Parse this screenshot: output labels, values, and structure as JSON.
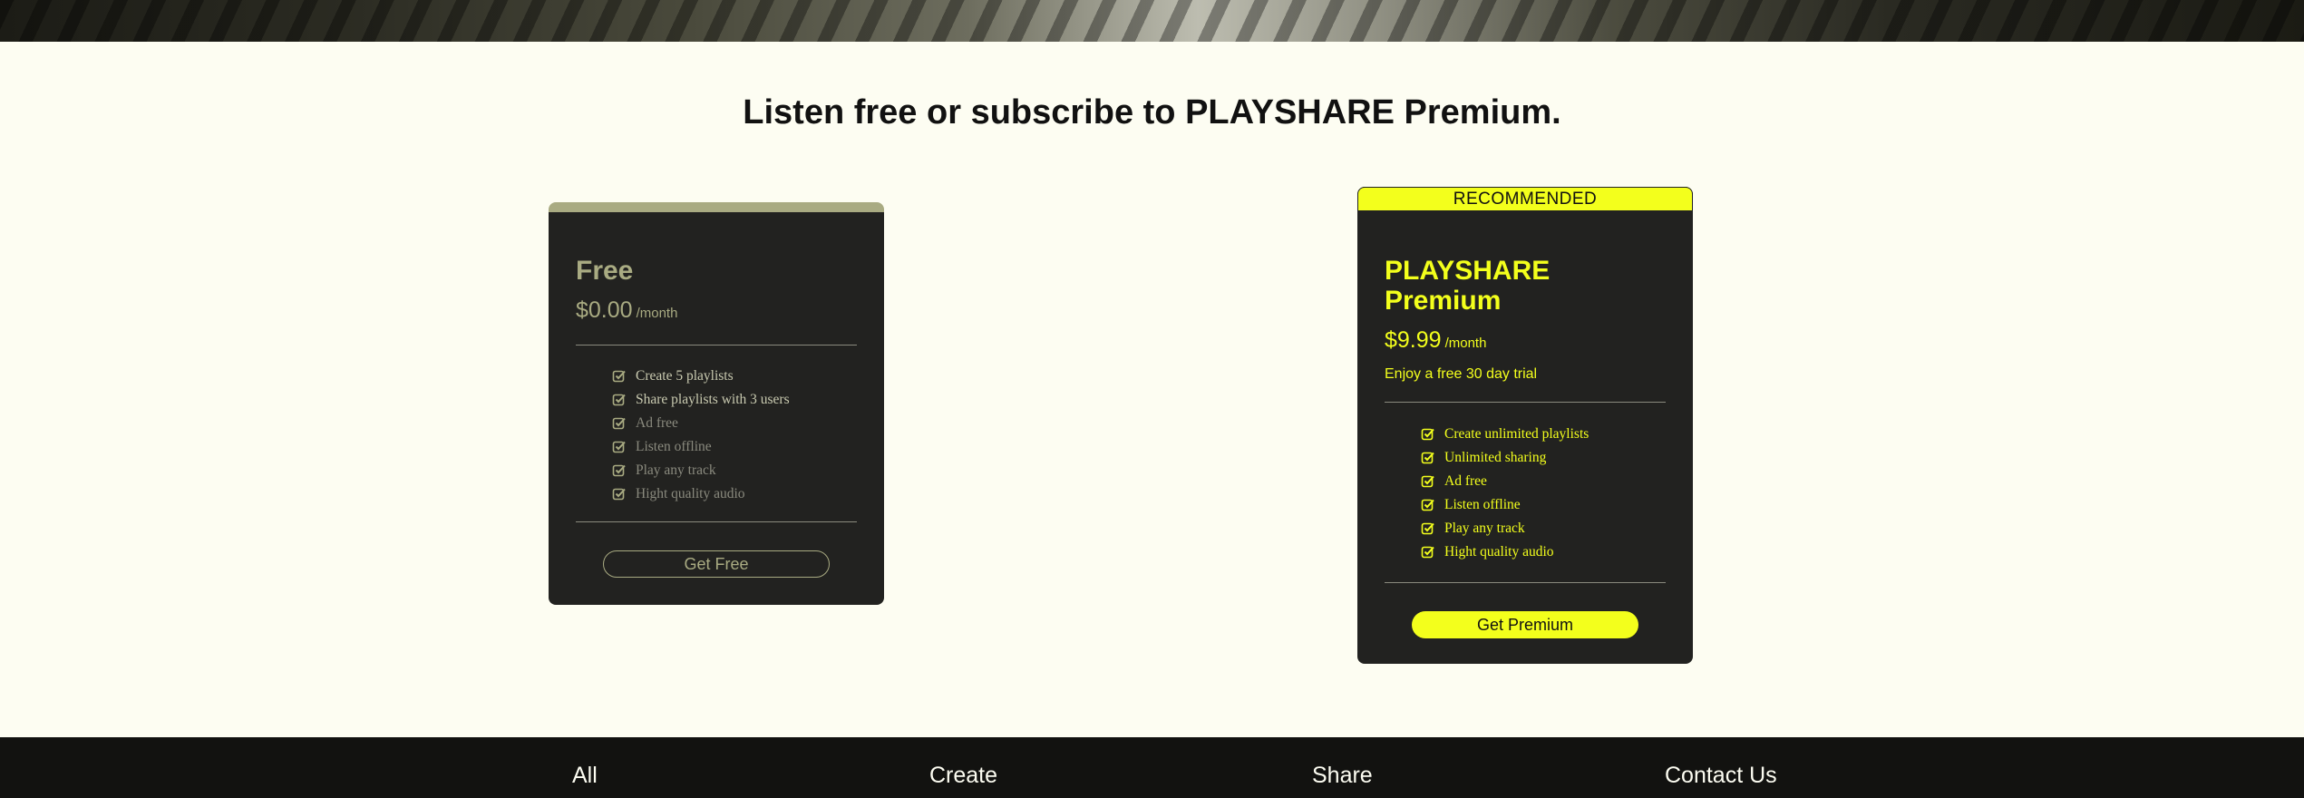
{
  "headline": {
    "part1": "Listen free or ",
    "part2": "subscribe",
    "part3": " to ",
    "part4": "PLAY",
    "part5": "SHARE",
    "part6": " ",
    "part7": "Premium",
    "part8": "."
  },
  "free_plan": {
    "name": "Free",
    "price": "$0.00",
    "period": "/month",
    "features": [
      {
        "label": "Create 5 playlists",
        "included": true
      },
      {
        "label": "Share playlists with 3 users",
        "included": true
      },
      {
        "label": "Ad free",
        "included": false
      },
      {
        "label": "Listen offline",
        "included": false
      },
      {
        "label": "Play any track",
        "included": false
      },
      {
        "label": "Hight quality audio",
        "included": false
      }
    ],
    "button_label": "Get Free"
  },
  "premium_plan": {
    "badge": "RECOMMENDED",
    "name_line1": "PLAYSHARE",
    "name_line2": "Premium",
    "price": "$9.99",
    "period": "/month",
    "trial": "Enjoy a free 30 day trial",
    "features": [
      {
        "label": "Create unlimited playlists"
      },
      {
        "label": "Unlimited sharing"
      },
      {
        "label": "Ad free"
      },
      {
        "label": "Listen offline"
      },
      {
        "label": "Play any track"
      },
      {
        "label": "Hight quality audio"
      }
    ],
    "button_label": "Get Premium"
  },
  "footer": {
    "links": [
      "All",
      "Create",
      "Share",
      "Contact Us"
    ]
  },
  "colors": {
    "accent": "#f3ff1c",
    "muted_accent": "#a9ab82",
    "card_bg": "#222220",
    "page_bg": "#fdfdf2",
    "footer_bg": "#121210"
  }
}
